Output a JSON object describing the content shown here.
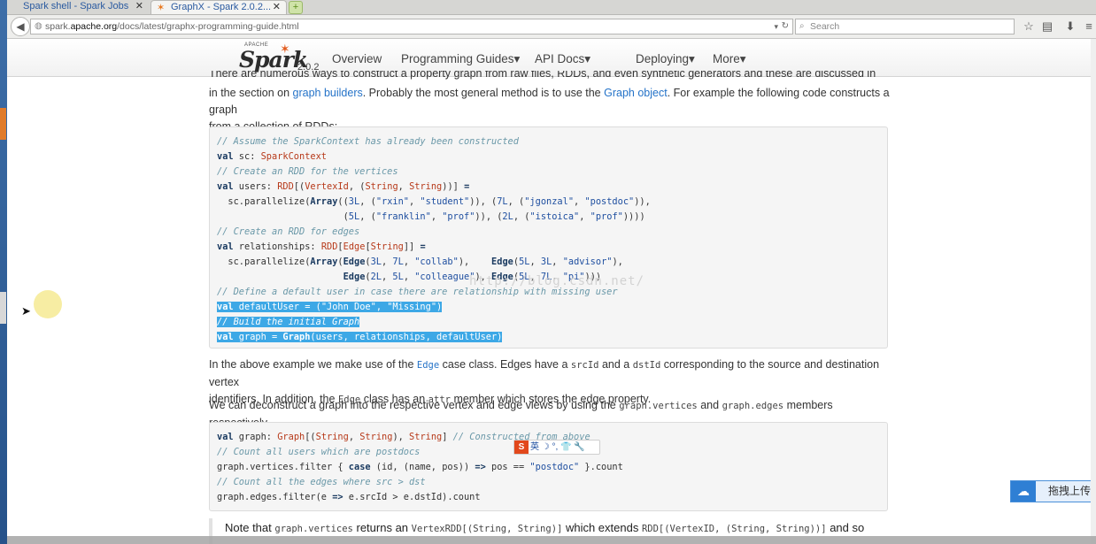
{
  "browser": {
    "tabs": [
      {
        "label": "Spark shell - Spark Jobs"
      },
      {
        "label": "GraphX - Spark 2.0.2..."
      }
    ],
    "url_prefix": "spark.",
    "url_host": "apache.org",
    "url_path": "/docs/latest/graphx-programming-guide.html",
    "search_placeholder": "Search"
  },
  "header": {
    "logo_small": "APACHE",
    "logo_word": "Spark",
    "version": "2.0.2",
    "nav": [
      "Overview",
      "Programming Guides▾",
      "API Docs▾",
      "Deploying▾",
      "More▾"
    ]
  },
  "content": {
    "cut_line": "There are numerous ways to construct a property graph from raw files, RDDs, and even synthetic generators and these are discussed in more detail",
    "p1": {
      "a": "in the section on ",
      "link1": "graph builders",
      "b": ". Probably the most general method is to use the ",
      "link2": "Graph object",
      "c": ". For example the following code constructs a graph",
      "d": "from a collection of RDDs:"
    },
    "p2": {
      "a": "In the above example we make use of the ",
      "code1": "Edge",
      "b": " case class. Edges have a ",
      "code2": "srcId",
      "c": " and a ",
      "code3": "dstId",
      "d": " corresponding to the source and destination vertex",
      "e": "identifiers. In addition, the ",
      "code4": "Edge",
      "f": " class has an ",
      "code5": "attr",
      "g": " member which stores the edge property."
    },
    "p3": {
      "a": "We can deconstruct a graph into the respective vertex and edge views by using the ",
      "code1": "graph.vertices",
      "b": " and ",
      "code2": "graph.edges",
      "c": " members respectively."
    },
    "note": {
      "a": "Note that ",
      "code1": "graph.vertices",
      "b": " returns an ",
      "code2": "VertexRDD[(String, String)]",
      "c": " which extends ",
      "code3": "RDD[(VertexID, (String, String))]",
      "d": " and so"
    }
  },
  "overlays": {
    "watermark": "http://blog.csdn.net/",
    "ime_letter": "S",
    "ime_rest": "英 ☽ °, 👕 🔧",
    "upload_label": "拖拽上传"
  }
}
